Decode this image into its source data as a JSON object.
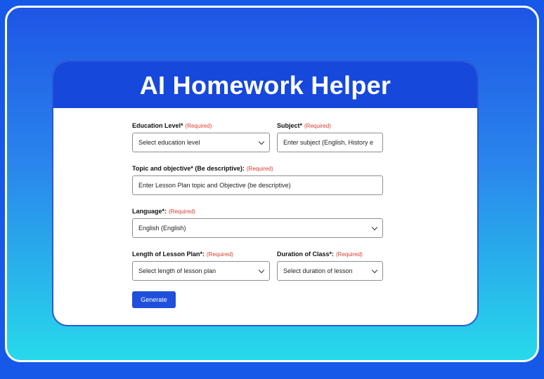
{
  "header": {
    "title": "AI Homework Helper"
  },
  "form": {
    "required_text": "(Required)",
    "education_level": {
      "label": "Education Level*",
      "value": "Select education level"
    },
    "subject": {
      "label": "Subject*",
      "placeholder": "Enter subject (English, History e"
    },
    "topic": {
      "label": "Topic and objective* (Be descriptive):",
      "placeholder": "Enter Lesson Plan topic and Objective (be descriptive)"
    },
    "language": {
      "label": "Language*:",
      "value": "English (English)"
    },
    "length": {
      "label": "Length of Lesson Plan*:",
      "value": "Select length of lesson plan"
    },
    "duration": {
      "label": "Duration of Class*:",
      "value": "Select duration of lesson"
    },
    "generate_label": "Generate"
  },
  "colors": {
    "background": "#1659e8",
    "header": "#1648dc",
    "button": "#1f4fdb",
    "required": "#d93a2b",
    "gradient_bottom": "#27d9ea"
  },
  "icons": [
    "chevron-down-icon"
  ]
}
